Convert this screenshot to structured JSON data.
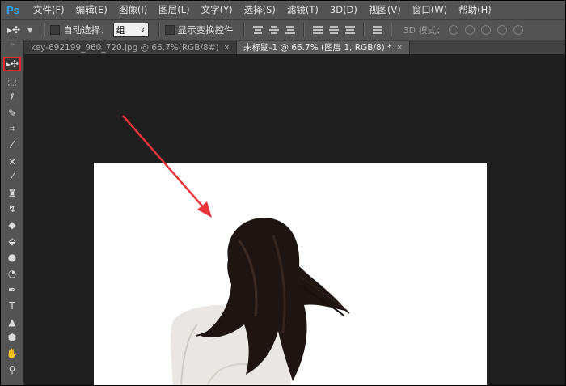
{
  "app": {
    "logo": "Ps"
  },
  "menu": [
    "文件(F)",
    "编辑(E)",
    "图像(I)",
    "图层(L)",
    "文字(Y)",
    "选择(S)",
    "滤镜(T)",
    "3D(D)",
    "视图(V)",
    "窗口(W)",
    "帮助(H)"
  ],
  "options": {
    "tool_glyph": "▸✣",
    "auto_select_label": "自动选择：",
    "auto_select_value": "组",
    "show_transform_label": "显示变换控件",
    "mode3d_label": "3D 模式："
  },
  "tabs": [
    {
      "label": "key-692199_960_720.jpg @ 66.7%(RGB/8#)",
      "close": "×"
    },
    {
      "label": "未标题-1 @ 66.7% (图层 1, RGB/8) *",
      "close": "×"
    }
  ],
  "toolbar": {
    "grip": "››",
    "tools": [
      {
        "name": "move-tool",
        "glyph": "▸✣"
      },
      {
        "name": "marquee-tool",
        "glyph": "⬚"
      },
      {
        "name": "lasso-tool",
        "glyph": "ℓ"
      },
      {
        "name": "quick-select-tool",
        "glyph": "✎"
      },
      {
        "name": "crop-tool",
        "glyph": "⌗"
      },
      {
        "name": "eyedropper-tool",
        "glyph": "⁄"
      },
      {
        "name": "healing-tool",
        "glyph": "✕"
      },
      {
        "name": "brush-tool",
        "glyph": "⁄"
      },
      {
        "name": "stamp-tool",
        "glyph": "♜"
      },
      {
        "name": "history-brush-tool",
        "glyph": "↯"
      },
      {
        "name": "eraser-tool",
        "glyph": "◆"
      },
      {
        "name": "paint-bucket-tool",
        "glyph": "⬙"
      },
      {
        "name": "blur-tool",
        "glyph": "●"
      },
      {
        "name": "dodge-tool",
        "glyph": "◔"
      },
      {
        "name": "pen-tool",
        "glyph": "✒"
      },
      {
        "name": "type-tool",
        "glyph": "T"
      },
      {
        "name": "path-select-tool",
        "glyph": "▲"
      },
      {
        "name": "shape-tool",
        "glyph": "⬢"
      },
      {
        "name": "hand-tool",
        "glyph": "✋"
      },
      {
        "name": "zoom-tool",
        "glyph": "⚲"
      }
    ]
  },
  "colors": {
    "highlight": "#e8242c",
    "arrow": "#e8343a",
    "canvas": "#ffffff"
  }
}
